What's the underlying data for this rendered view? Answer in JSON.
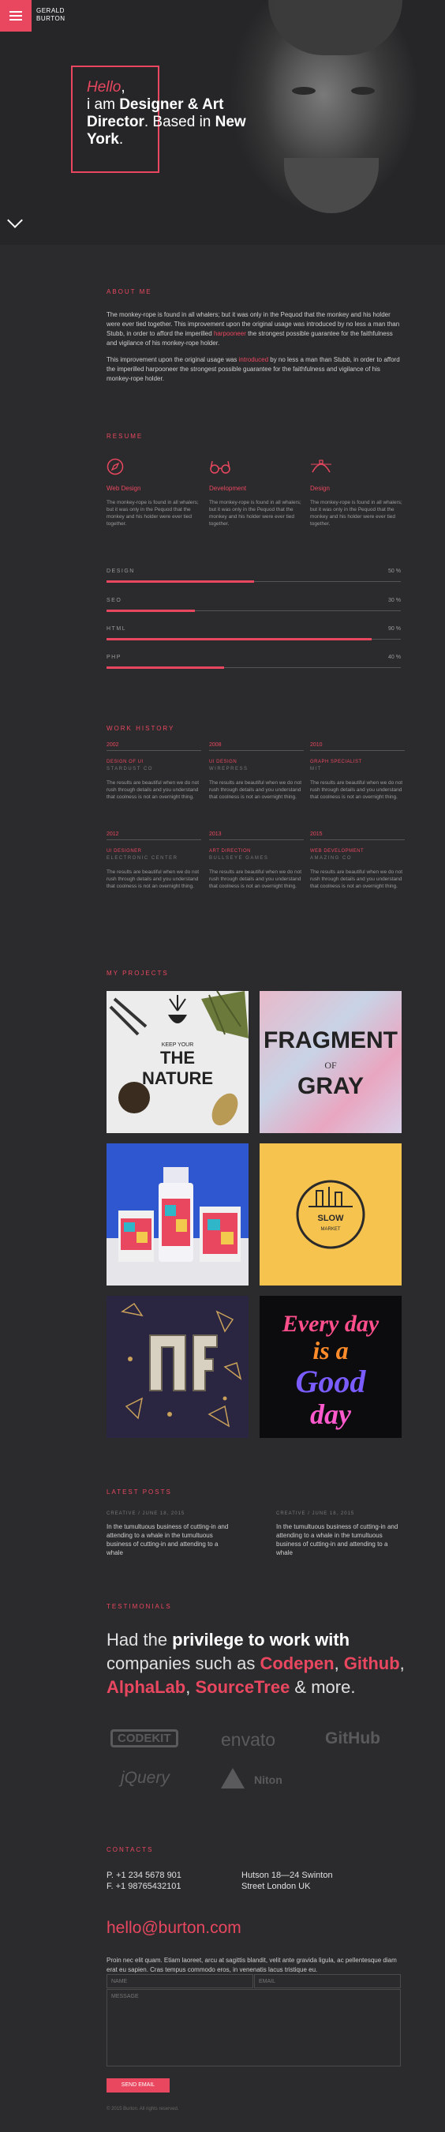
{
  "header": {
    "brand_line1": "GERALD",
    "brand_line2": "BURTON",
    "menu_icon": "hamburger-icon"
  },
  "hero": {
    "hello": "Hello",
    "comma1": ",",
    "line_prefix": "i am",
    "role_bold": "Designer & Art Director",
    "based": ". Based in",
    "city": "New York",
    "period": ".",
    "scroll_icon": "chevron-down-icon"
  },
  "about": {
    "title": "ABOUT ME",
    "para1_before": "The monkey-rope is found in all whalers; but it was only in the Pequod that the monkey and his holder were ever tied together. This improvement upon the original usage was introduced by no less a man than Stubb, in order to afford the imperilled ",
    "para1_link": "harpooneer",
    "para1_after": " the strongest possible guarantee for the faithfulness and vigilance of his monkey-rope holder.",
    "para2_before": "This improvement upon the original usage was ",
    "para2_link": "introduced",
    "para2_after": " by no less a man than Stubb, in order to afford the imperilled harpooneer the strongest possible guarantee for the faithfulness and vigilance of his monkey-rope holder."
  },
  "resume": {
    "title": "RESUME",
    "columns": [
      {
        "icon": "compass-icon",
        "title": "Web Design",
        "text": "The monkey-rope is found in all whalers; but it was only in the Pequod that the monkey and his holder were ever tied together."
      },
      {
        "icon": "glasses-icon",
        "title": "Development",
        "text": "The monkey-rope is found in all whalers; but it was only in the Pequod that the monkey and his holder were ever tied together."
      },
      {
        "icon": "bezier-icon",
        "title": "Design",
        "text": "The monkey-rope is found in all whalers; but it was only in the Pequod that the monkey and his holder were ever tied together."
      }
    ],
    "skills": [
      {
        "label": "DESIGN",
        "percent_text": "50 %",
        "percent": 50
      },
      {
        "label": "SEO",
        "percent_text": "30 %",
        "percent": 30
      },
      {
        "label": "HTML",
        "percent_text": "90 %",
        "percent": 90
      },
      {
        "label": "PHP",
        "percent_text": "40 %",
        "percent": 40
      }
    ]
  },
  "work": {
    "title": "WORK HISTORY",
    "jobs": [
      {
        "year": "2002",
        "role": "DESIGN OF UI",
        "company": "STARDUST CO",
        "desc": "The results are beautiful when we do not rush through details and you understand that coolness is not an overnight thing."
      },
      {
        "year": "2008",
        "role": "UI DESIGN",
        "company": "WIREPRESS",
        "desc": "The results are beautiful when we do not rush through details and you understand that coolness is not an overnight thing."
      },
      {
        "year": "2010",
        "role": "GRAPH SPECIALIST",
        "company": "MIT",
        "desc": "The results are beautiful when we do not rush through details and you understand that coolness is not an overnight thing."
      },
      {
        "year": "2012",
        "role": "UI DESIGNER",
        "company": "ELECTRONIC CENTER",
        "desc": "The results are beautiful when we do not rush through details and you understand that coolness is not an overnight thing."
      },
      {
        "year": "2013",
        "role": "ART DIRECTION",
        "company": "BULLSEYE GAMES",
        "desc": "The results are beautiful when we do not rush through details and you understand that coolness is not an overnight thing."
      },
      {
        "year": "2015",
        "role": "WEB DEVELOPMENT",
        "company": "AMAZING CO",
        "desc": "The results are beautiful when we do not rush through details and you understand that coolness is not an overnight thing."
      }
    ]
  },
  "projects": {
    "title": "MY PROJECTS",
    "items": [
      {
        "caption_1": "KEEP YOUR",
        "caption_2": "THE",
        "caption_3": "NATURE"
      },
      {
        "caption_1": "FRAGMENT",
        "caption_2": "OF",
        "caption_3": "GRAY"
      },
      {
        "caption_1": ""
      },
      {
        "caption_1": "SLOW",
        "caption_2": "MARKET"
      },
      {
        "caption_1": ""
      },
      {
        "caption_1": "Every day",
        "caption_2": "is a",
        "caption_3": "Good",
        "caption_4": "day"
      }
    ]
  },
  "posts": {
    "title": "LATEST POSTS",
    "items": [
      {
        "meta": "CREATIVE / JUNE 18, 2015",
        "title": "In the tumultuous business of cutting-in and attending to a whale in the tumultuous business of cutting-in and attending to a whale"
      },
      {
        "meta": "CREATIVE / JUNE 18, 2015",
        "title": "In the tumultuous business of cutting-in and attending to a whale in the tumultuous business of cutting-in and attending to a whale"
      }
    ]
  },
  "testimonials": {
    "title": "TESTIMONIALS",
    "t1": "Had the ",
    "t2": "privilege to work with",
    "t3": " companies such as ",
    "c1": "Codepen",
    "sep1": ", ",
    "c2": "Github",
    "sep2": ", ",
    "c3": "AlphaLab",
    "sep3": ", ",
    "c4": "SourceTree",
    "t4": " & more.",
    "logos": [
      "CODEKIT",
      "envato",
      "GitHub",
      "jQuery",
      "Niton"
    ]
  },
  "contact": {
    "title": "CONTACTS",
    "phone": "P. +1 234 5678 901",
    "fax": "F. +1 98765432101",
    "address1": "Hutson 18—24 Swinton",
    "address2": "Street London UK",
    "email": "hello@burton.com",
    "para": "Proin nec elit quam. Etiam laoreet, arcu at sagittis blandit, velit ante gravida ligula, ac pellentesque diam erat eu sapien. Cras tempus commodo eros, in venenatis lacus tristique eu.",
    "name_placeholder": "NAME",
    "email_placeholder": "EMAIL",
    "message_placeholder": "MESSAGE",
    "send_label": "SEND EMAIL",
    "copyright": "© 2015 Burton. All rights reserved."
  },
  "colors": {
    "accent": "#e8475f",
    "background": "#2b2b2d"
  }
}
